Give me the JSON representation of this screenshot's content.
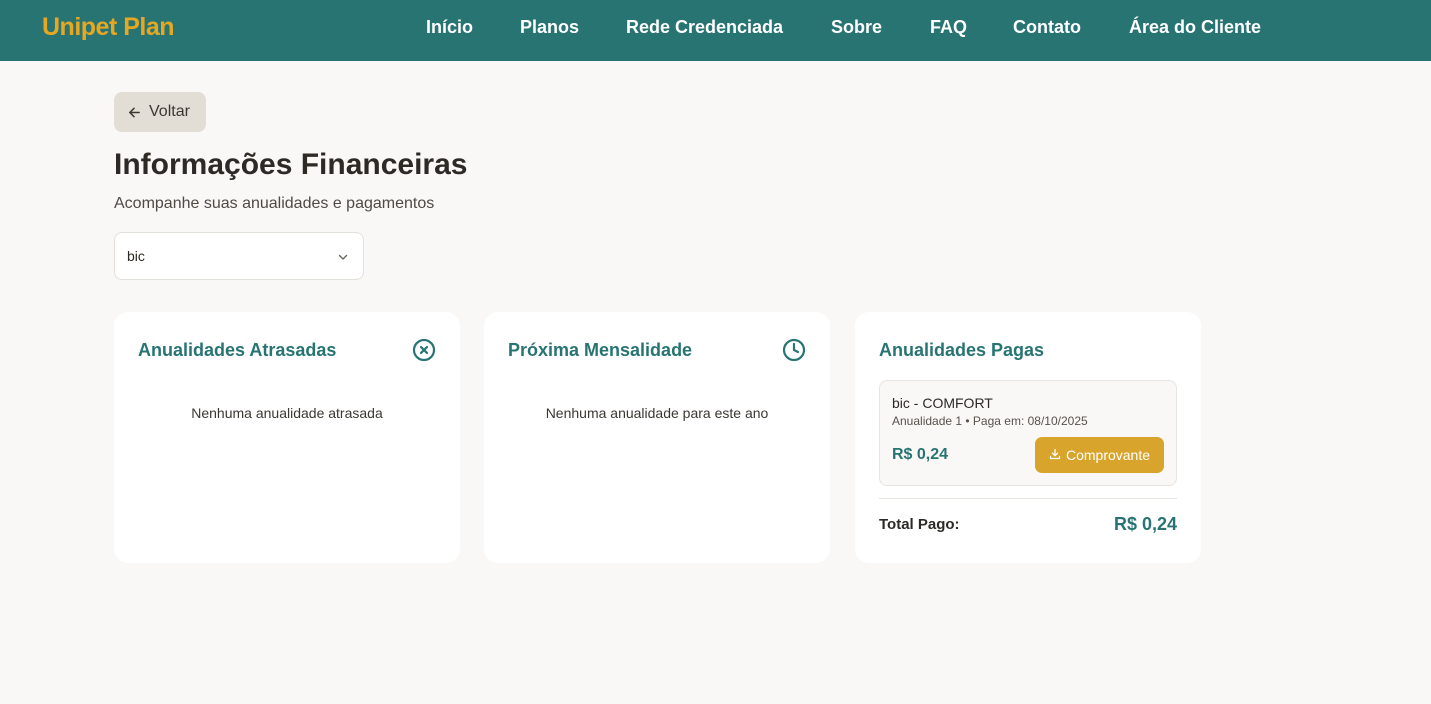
{
  "brand": {
    "name": "Unipet Plan"
  },
  "nav": {
    "items": [
      "Início",
      "Planos",
      "Rede Credenciada",
      "Sobre",
      "FAQ",
      "Contato",
      "Área do Cliente"
    ]
  },
  "back_button": {
    "label": "Voltar",
    "icon": "arrow-left-icon"
  },
  "page": {
    "title": "Informações Financeiras",
    "subtitle": "Acompanhe suas anualidades e pagamentos"
  },
  "pet_select": {
    "value": "bic",
    "icon": "chevron-down-icon"
  },
  "cards": {
    "overdue": {
      "title": "Anualidades Atrasadas",
      "icon": "x-circle-icon",
      "empty_text": "Nenhuma anualidade atrasada"
    },
    "next": {
      "title": "Próxima Mensalidade",
      "icon": "clock-icon",
      "empty_text": "Nenhuma anualidade para este ano"
    },
    "paid": {
      "title": "Anualidades Pagas",
      "items": [
        {
          "name": "bic - COMFORT",
          "meta": "Anualidade 1 • Paga em: 08/10/2025",
          "amount": "R$ 0,24",
          "button_label": "Comprovante",
          "button_icon": "download-icon"
        }
      ],
      "total_label": "Total Pago:",
      "total_value": "R$ 0,24"
    }
  },
  "colors": {
    "header": "#277473",
    "brand": "#e6a823",
    "accent": "#277473",
    "button": "#d8a42b",
    "background": "#f9f8f6"
  }
}
